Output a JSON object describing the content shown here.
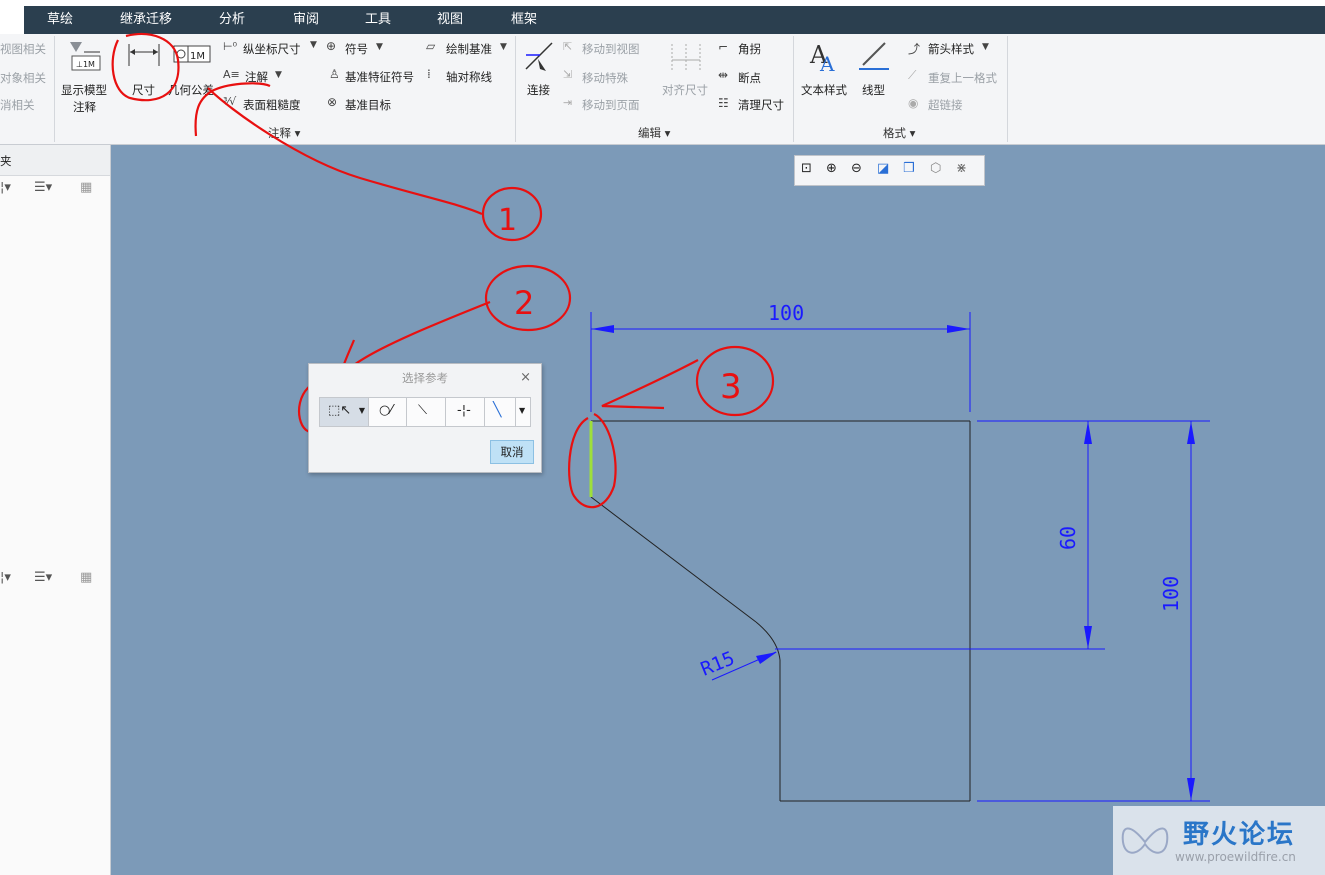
{
  "tabs": [
    "草绘",
    "继承迁移",
    "分析",
    "审阅",
    "工具",
    "视图",
    "框架"
  ],
  "left_cut": [
    "视图相关",
    "对象相关",
    "消相关"
  ],
  "annotate": {
    "show_model": [
      "显示模型",
      "注释"
    ],
    "dimension": "尺寸",
    "geo_tol": "几何公差",
    "ordinate": "纵坐标尺寸",
    "note": "注解",
    "surface_finish": "表面粗糙度",
    "symbol": "符号",
    "datum_feature": "基准特征符号",
    "datum_target": "基准目标",
    "draw_datum": "绘制基准",
    "axis_sym": "轴对称线",
    "group": "注释"
  },
  "edit": {
    "connect": "连接",
    "move_view": "移动到视图",
    "move_special": "移动特殊",
    "move_page": "移动到页面",
    "align_dim": "对齐尺寸",
    "corner": "角拐",
    "break": "断点",
    "cleanup": "清理尺寸",
    "group": "编辑"
  },
  "format": {
    "text_style": "文本样式",
    "line_style": "线型",
    "arrow_style": "箭头样式",
    "repeat_format": "重复上一格式",
    "hyperlink": "超链接",
    "group": "格式"
  },
  "left_panel": {
    "header_char": "夹"
  },
  "dialog": {
    "title": "选择参考",
    "close": "×",
    "cancel": "取消"
  },
  "drawing": {
    "dim_top": "100",
    "dim_right_inner": "60",
    "dim_right_outer": "100",
    "radius": "R15",
    "dim_color": "#1a1aff",
    "select_color": "#9ee03a"
  },
  "markers": [
    "1",
    "2",
    "3"
  ],
  "watermark": {
    "text": "野火论坛",
    "url": "www.proewildfire.cn"
  }
}
